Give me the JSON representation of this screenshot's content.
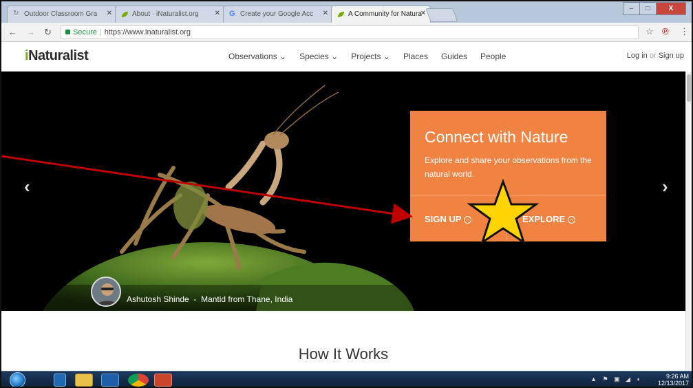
{
  "browser": {
    "tabs": [
      {
        "title": "Outdoor Classroom Gra",
        "active": false
      },
      {
        "title": "About · iNaturalist.org",
        "active": false
      },
      {
        "title": "Create your Google Acc",
        "active": false
      },
      {
        "title": "A Community for Natura",
        "active": true
      }
    ],
    "secure_label": "Secure",
    "url": "https://www.inaturalist.org",
    "window_buttons": {
      "minimize": "–",
      "maximize": "□",
      "close": "X"
    }
  },
  "site": {
    "logo_prefix": "i",
    "logo_rest": "Naturalist",
    "nav": [
      "Observations ⌄",
      "Species ⌄",
      "Projects ⌄",
      "Places",
      "Guides",
      "People"
    ],
    "login": "Log in",
    "or": "or",
    "signup": "Sign up"
  },
  "hero": {
    "title": "Connect with Nature",
    "subtitle": "Explore and share your observations from the natural world.",
    "signup_label": "SIGN UP",
    "explore_label": "EXPLORE",
    "photographer": "Ashutosh Shinde",
    "photo_caption": "Mantid from Thane, India",
    "caption_separator": "-",
    "prev_arrow": "‹",
    "next_arrow": "›"
  },
  "section": {
    "how_title": "How It Works"
  },
  "taskbar": {
    "time": "9:26 AM",
    "date": "12/13/2017",
    "apps": [
      "start-button",
      "media-player",
      "file-explorer",
      "outlook",
      "chrome",
      "powerpoint"
    ]
  },
  "colors": {
    "cta_orange": "#f08342",
    "inat_green": "#74ac00",
    "annotation_arrow": "#c00000",
    "star_fill": "#ffd400"
  }
}
